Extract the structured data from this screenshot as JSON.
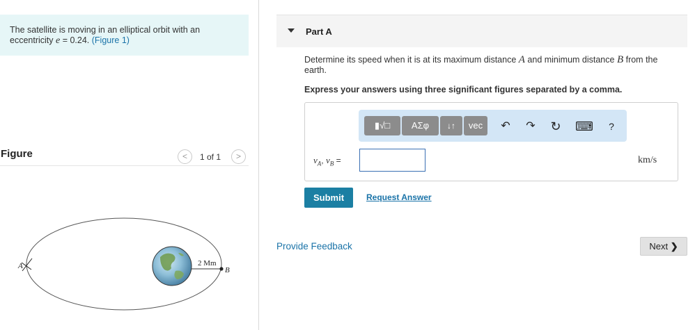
{
  "problem": {
    "text_before": "The satellite is moving in an elliptical orbit with an eccentricity ",
    "symbol": "e",
    "text_eq": " = 0.24. ",
    "figure_link": "(Figure 1)"
  },
  "figure": {
    "title": "Figure",
    "pager": "1 of 1",
    "prev_glyph": "<",
    "next_glyph": ">",
    "labels": {
      "point_a": "A",
      "point_b": "B",
      "distance": "2 Mm"
    }
  },
  "part": {
    "title": "Part A",
    "question_before": "Determine its speed when it is at its maximum distance ",
    "symbol_a": "A",
    "question_mid": " and minimum distance ",
    "symbol_b": "B",
    "question_after": " from the earth.",
    "instruction": "Express your answers using three significant figures separated by a comma."
  },
  "toolbar": {
    "templates_label": "▮√□",
    "symbols_label": "ΑΣφ",
    "arrows_label": "↓↑",
    "vec_label": "vec",
    "undo_icon": "↶",
    "redo_icon": "↷",
    "reset_icon": "↻",
    "keyboard_icon": "⌨",
    "help_label": "?"
  },
  "answer": {
    "var_label": "vA, vB",
    "var_a": "v",
    "sub_a": "A",
    "sep": ", ",
    "var_b": "v",
    "sub_b": "B",
    "eq": " =",
    "value": "",
    "units": "km/s"
  },
  "actions": {
    "submit": "Submit",
    "request_answer": "Request Answer",
    "provide_feedback": "Provide Feedback",
    "next": "Next",
    "next_chevron": "❯"
  },
  "colors": {
    "accent": "#1b7fa3",
    "link": "#1a73a8",
    "problem_bg": "#e6f6f7",
    "toolbar_bg": "#d3e6f6"
  }
}
